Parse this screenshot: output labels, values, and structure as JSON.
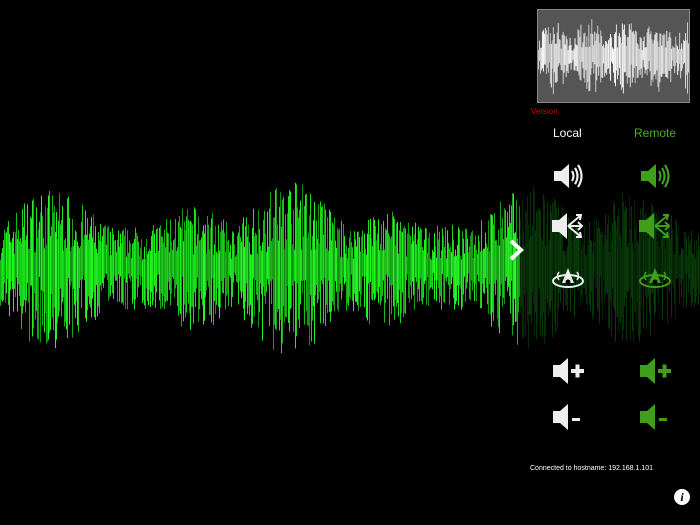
{
  "app": {
    "version_label": "Version",
    "status_text": "Connected to hostname: 192.168.1.101"
  },
  "columns": {
    "local_label": "Local",
    "remote_label": "Remote"
  },
  "controls": {
    "rows": [
      {
        "icon": "speaker-icon"
      },
      {
        "icon": "speaker-output-routing-icon"
      },
      {
        "icon": "surround-sound-icon"
      },
      {
        "icon": "volume-up-icon"
      },
      {
        "icon": "volume-down-icon"
      }
    ]
  },
  "colors": {
    "background": "#000000",
    "waveform_green": "#22ff22",
    "local_icon": "#eeeeee",
    "remote_icon": "#3f9f1a",
    "remote_label": "#4caf1f",
    "version_text": "#d10000"
  },
  "icons": {
    "panel_toggle": "chevron-right-icon",
    "info": "info-icon"
  }
}
